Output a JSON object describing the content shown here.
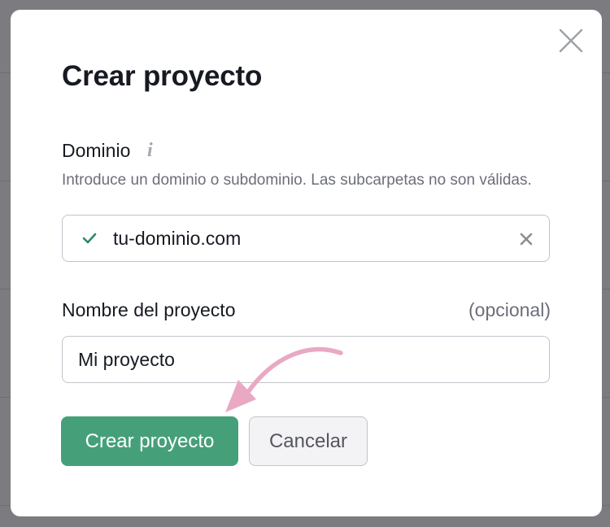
{
  "dialog": {
    "title": "Crear proyecto",
    "close_icon": "close-icon"
  },
  "domain": {
    "label": "Dominio",
    "info_icon": "info-icon",
    "info_glyph": "i",
    "hint": "Introduce un dominio o subdominio. Las subcarpetas no son válidas.",
    "value": "tu-dominio.com",
    "status_icon": "check-icon",
    "clear_icon": "clear-icon"
  },
  "project_name": {
    "label": "Nombre del proyecto",
    "optional_label": "(opcional)",
    "value": "Mi proyecto"
  },
  "buttons": {
    "create_label": "Crear proyecto",
    "cancel_label": "Cancelar"
  },
  "annotation": {
    "arrow_icon": "pointer-arrow-icon"
  },
  "colors": {
    "primary": "#45a07a",
    "check": "#2e8a63",
    "annotation_arrow": "#e9a9c3"
  }
}
